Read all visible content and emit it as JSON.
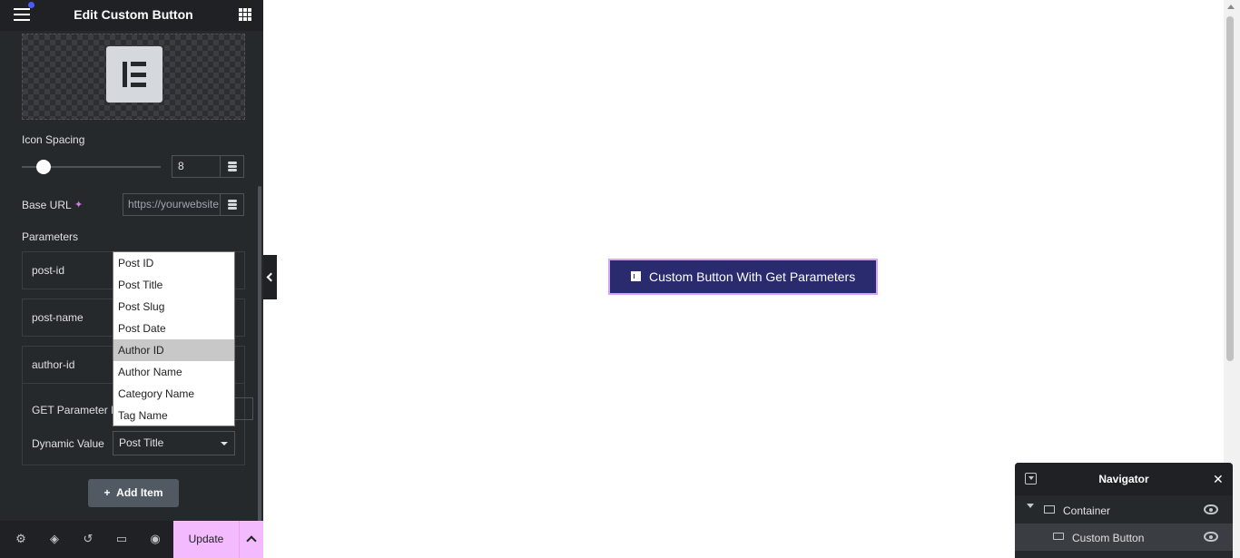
{
  "header": {
    "title": "Edit Custom Button"
  },
  "icon_spacing": {
    "label": "Icon Spacing",
    "value": "8"
  },
  "base_url": {
    "label": "Base URL",
    "placeholder": "https://yourwebsite"
  },
  "parameters": {
    "label": "Parameters",
    "items": [
      "post-id",
      "post-name",
      "author-id"
    ],
    "get_param_label": "GET Parameter N",
    "dynamic_value_label": "Dynamic Value",
    "dynamic_value_selected": "Post Title",
    "add_item_label": "Add Item"
  },
  "dropdown": {
    "options": [
      "Post ID",
      "Post Title",
      "Post Slug",
      "Post Date",
      "Author ID",
      "Author Name",
      "Category Name",
      "Tag Name"
    ],
    "highlighted": "Author ID"
  },
  "footer": {
    "update_label": "Update"
  },
  "canvas": {
    "button_text": "Custom Button With Get Parameters"
  },
  "navigator": {
    "title": "Navigator",
    "rows": [
      "Container",
      "Custom Button"
    ]
  },
  "colors": {
    "panel_bg": "#26292c",
    "accent_pink": "#f3bafd",
    "button_bg": "#2a2a6e"
  }
}
